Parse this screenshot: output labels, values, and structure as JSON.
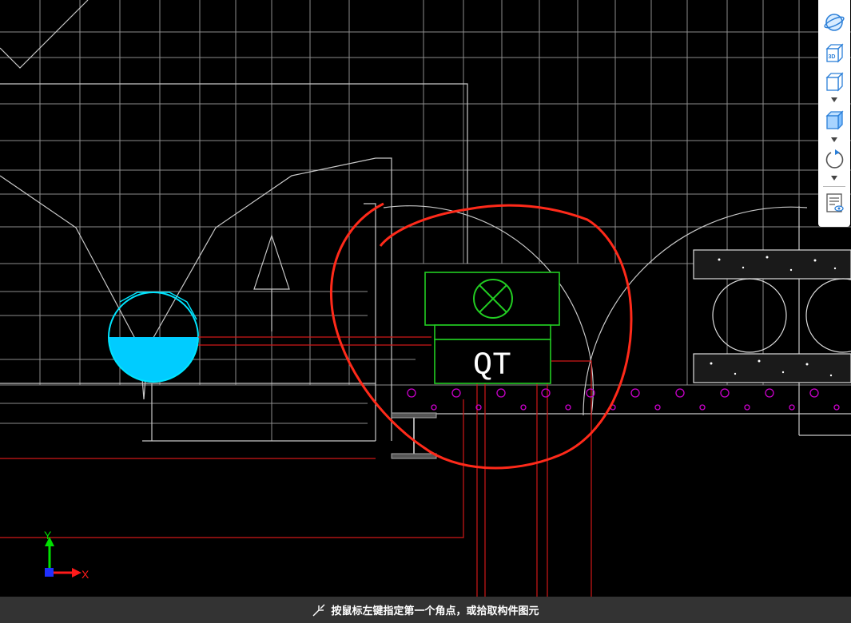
{
  "canvas": {
    "qt_label": "QT",
    "axis_x_label": "X",
    "axis_y_label": "Y"
  },
  "toolbar": {
    "items": [
      {
        "name": "orbit-icon"
      },
      {
        "name": "view-3d-icon",
        "text": "3D"
      },
      {
        "name": "view-cube-icon"
      },
      {
        "name": "shaded-cube-icon"
      },
      {
        "name": "rotate-icon"
      },
      {
        "name": "display-settings-icon"
      }
    ]
  },
  "status": {
    "icon": "pick-cursor-icon",
    "message": "按鼠标左键指定第一个角点，或拾取构件图元"
  },
  "colors": {
    "background": "#000000",
    "grid": "#8d8d8d",
    "annotation_red": "#ff2a1a",
    "pipe_cyan": "#00ccff",
    "component_green": "#22cc22",
    "hatch_magenta": "#cc00cc",
    "status_bar": "#333333"
  }
}
